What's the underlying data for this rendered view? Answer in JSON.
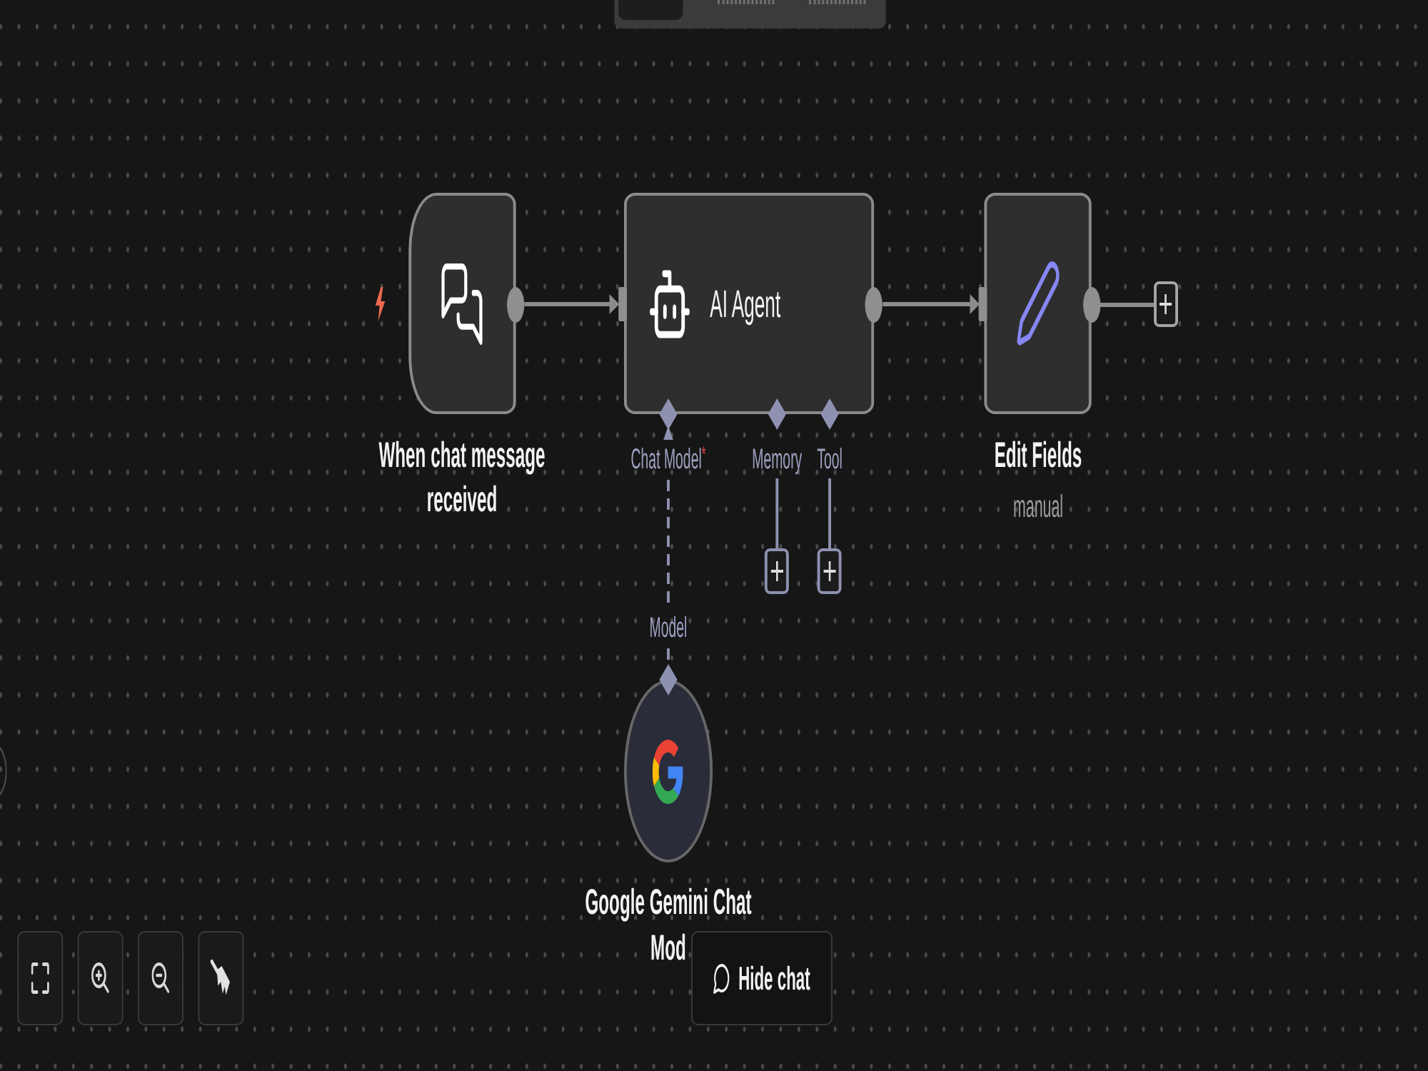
{
  "view_switcher": {
    "tabs": [
      {
        "selected": true
      },
      {
        "selected": false
      },
      {
        "selected": false
      }
    ]
  },
  "canvas": {
    "edge_node_cut_off": true
  },
  "workflow": {
    "nodes": [
      {
        "kind": "trigger",
        "label": "When chat message received",
        "output_connected": true
      },
      {
        "kind": "agent",
        "label": "AI Agent",
        "output_connected": true,
        "ports": [
          {
            "label": "Chat Model",
            "required_mark": "*",
            "connected": true
          },
          {
            "label": "Memory",
            "connected": false
          },
          {
            "label": "Tool",
            "connected": false
          }
        ]
      },
      {
        "kind": "action",
        "label": "Edit Fields",
        "subtitle": "manual",
        "output_connected": false
      },
      {
        "kind": "model",
        "label": "Google Gemini Chat Mod",
        "port_label": "Model"
      }
    ]
  },
  "controls": [
    {
      "kind": "fit-view"
    },
    {
      "kind": "zoom-in"
    },
    {
      "kind": "zoom-out"
    },
    {
      "kind": "tidy-up"
    }
  ],
  "chat_toggle": {
    "label": "Hide chat"
  }
}
